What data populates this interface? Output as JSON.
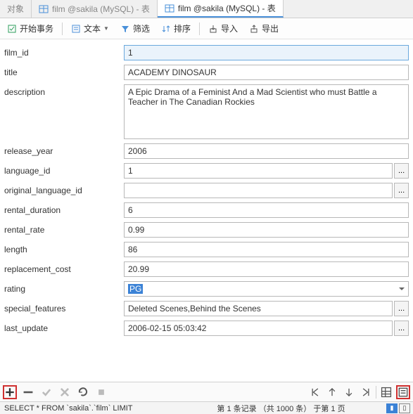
{
  "tabs": {
    "object": "对象",
    "film1": "film @sakila (MySQL) - 表",
    "film2": "film @sakila (MySQL) - 表"
  },
  "toolbar": {
    "begin": "开始事务",
    "text": "文本",
    "filter": "筛选",
    "sort": "排序",
    "import": "导入",
    "export": "导出"
  },
  "fields": {
    "film_id": {
      "label": "film_id",
      "value": "1"
    },
    "title": {
      "label": "title",
      "value": "ACADEMY DINOSAUR"
    },
    "description": {
      "label": "description",
      "value": "A Epic Drama of a Feminist And a Mad Scientist who must Battle a Teacher in The Canadian Rockies"
    },
    "release_year": {
      "label": "release_year",
      "value": "2006"
    },
    "language_id": {
      "label": "language_id",
      "value": "1"
    },
    "original_language_id": {
      "label": "original_language_id",
      "value": ""
    },
    "rental_duration": {
      "label": "rental_duration",
      "value": "6"
    },
    "rental_rate": {
      "label": "rental_rate",
      "value": "0.99"
    },
    "length": {
      "label": "length",
      "value": "86"
    },
    "replacement_cost": {
      "label": "replacement_cost",
      "value": "20.99"
    },
    "rating": {
      "label": "rating",
      "value": "PG"
    },
    "special_features": {
      "label": "special_features",
      "value": "Deleted Scenes,Behind the Scenes"
    },
    "last_update": {
      "label": "last_update",
      "value": "2006-02-15 05:03:42"
    }
  },
  "ellipsis": "...",
  "status": {
    "sql": "SELECT * FROM `sakila`.`film` LIMIT",
    "rec": "第 1 条记录 （共 1000 条） 于第 1 页"
  }
}
